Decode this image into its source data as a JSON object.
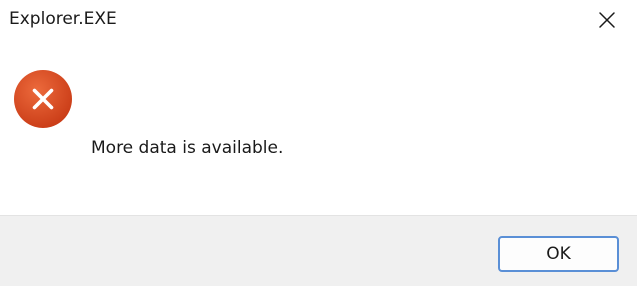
{
  "window": {
    "title": "Explorer.EXE"
  },
  "message": {
    "text": "More data is available.",
    "icon": "error-icon"
  },
  "buttons": {
    "ok_label": "OK"
  },
  "colors": {
    "error_icon": "#d9471e",
    "button_border": "#5a8fd6",
    "footer_bg": "#f0f0f0"
  }
}
